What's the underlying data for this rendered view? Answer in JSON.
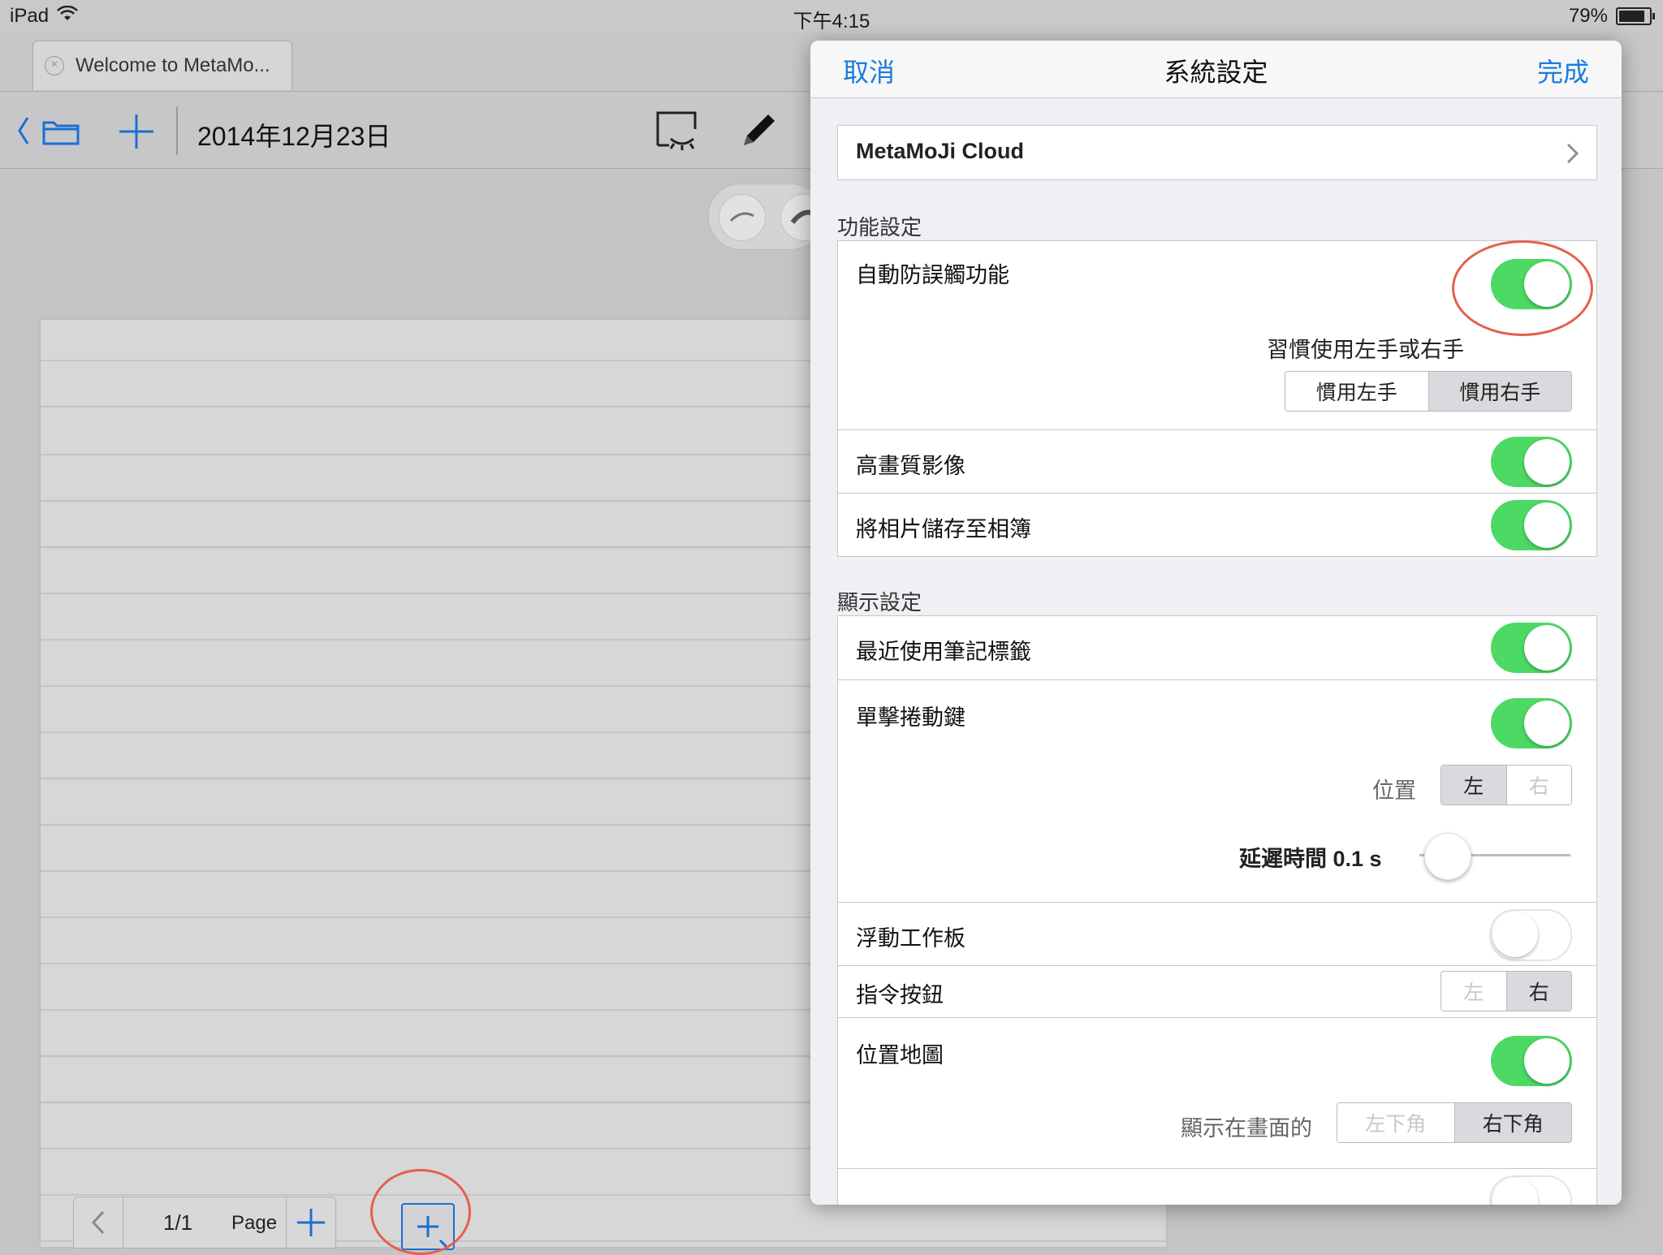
{
  "status_bar": {
    "device": "iPad",
    "time": "下午4:15",
    "battery": "79%",
    "battery_level": 0.79
  },
  "tab": {
    "title": "Welcome to MetaMo..."
  },
  "toolbar": {
    "date_title": "2014年12月23日"
  },
  "page_nav": {
    "page_count": "1/1",
    "page_label": "Page"
  },
  "settings": {
    "nav": {
      "cancel": "取消",
      "title": "系統設定",
      "done": "完成"
    },
    "cloud_label": "MetaMoJi Cloud",
    "function_section": {
      "header": "功能設定",
      "palm_rejection": {
        "label": "自動防誤觸功能",
        "on": true
      },
      "handedness": {
        "label": "習慣使用左手或右手",
        "left": "慣用左手",
        "right": "慣用右手",
        "selected": "right"
      },
      "high_quality": {
        "label": "高畫質影像",
        "on": true
      },
      "save_photos": {
        "label": "將相片儲存至相簿",
        "on": true
      }
    },
    "display_section": {
      "header": "顯示設定",
      "recent_tags": {
        "label": "最近使用筆記標籤",
        "on": true
      },
      "scroll_button": {
        "label": "單擊捲動鍵",
        "on": true,
        "position_label": "位置",
        "left": "左",
        "right": "右",
        "selected": "left",
        "delay_label": "延遲時間 0.1 s",
        "delay_value": 0.1
      },
      "floating_palette": {
        "label": "浮動工作板",
        "on": false
      },
      "command_button": {
        "label": "指令按鈕",
        "left": "左",
        "right": "右",
        "selected": "right"
      },
      "location_map": {
        "label": "位置地圖",
        "on": true,
        "show_label": "顯示在畫面的",
        "left": "左下角",
        "right": "右下角",
        "selected": "right"
      }
    }
  },
  "colors": {
    "accent": "#1a7be0",
    "toggle_on": "#4cd964",
    "highlight_circle": "#e2614c"
  }
}
